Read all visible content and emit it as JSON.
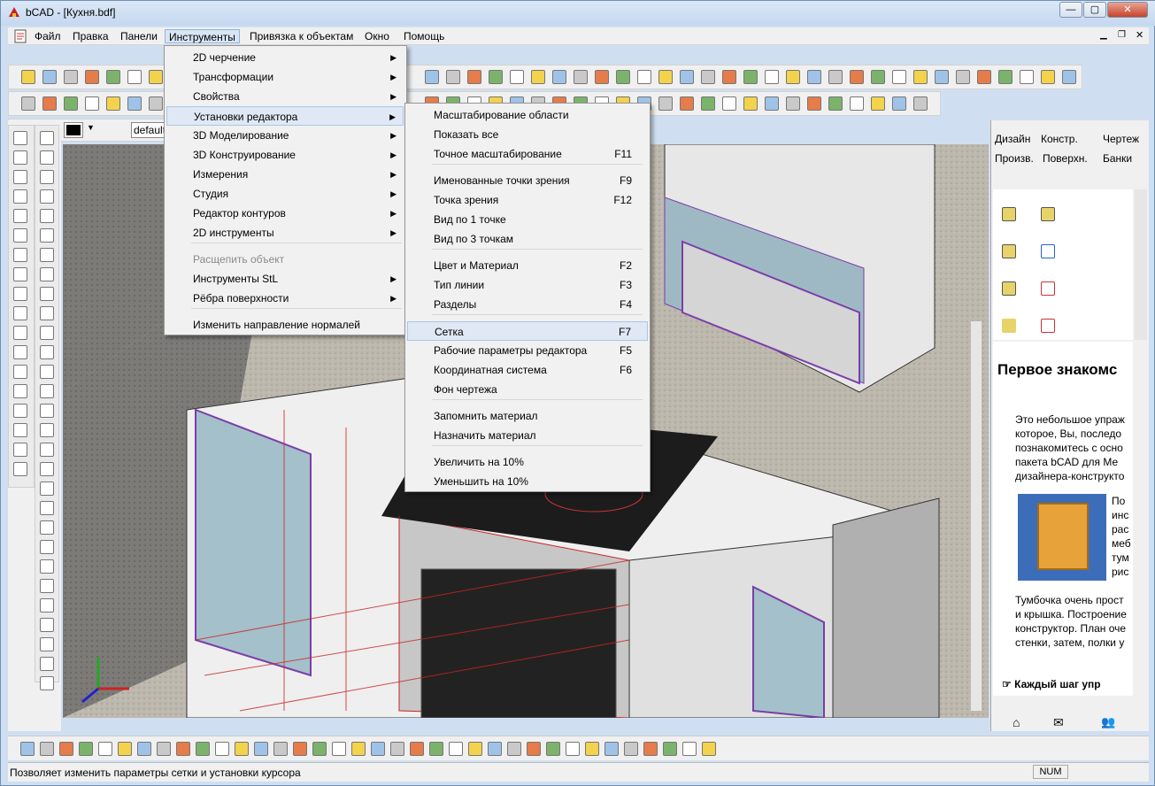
{
  "window": {
    "title": "bCAD - [Кухня.bdf]",
    "min": "—",
    "max": "▢",
    "close": "✕"
  },
  "menubar": [
    "Файл",
    "Правка",
    "Панели",
    "Инструменты",
    "Привязка к объектам",
    "Окно",
    "Помощь"
  ],
  "toolbar": {
    "layer_value": "default"
  },
  "tools_menu": {
    "items": [
      {
        "label": "2D черчение",
        "sub": true
      },
      {
        "label": "Трансформации",
        "sub": true
      },
      {
        "label": "Свойства",
        "sub": true
      },
      {
        "label": "Установки редактора",
        "sub": true,
        "active": true
      },
      {
        "label": "3D Моделирование",
        "sub": true
      },
      {
        "label": "3D Конструирование",
        "sub": true
      },
      {
        "label": "Измерения",
        "sub": true
      },
      {
        "label": "Студия",
        "sub": true
      },
      {
        "label": "Редактор контуров",
        "sub": true
      },
      {
        "label": "2D инструменты",
        "sub": true
      },
      {
        "label": "Расщепить объект",
        "disabled": true
      },
      {
        "label": "Инструменты StL",
        "sub": true
      },
      {
        "label": "Рёбра поверхности",
        "sub": true
      },
      {
        "label": "Изменить направление нормалей"
      }
    ]
  },
  "editor_menu": {
    "items": [
      {
        "label": "Масштабирование области",
        "shortcut": ""
      },
      {
        "label": "Показать все",
        "shortcut": ""
      },
      {
        "label": "Точное масштабирование",
        "shortcut": "F11"
      },
      {
        "label": "Именованные точки зрения",
        "shortcut": "F9"
      },
      {
        "label": "Точка зрения",
        "shortcut": "F12"
      },
      {
        "label": "Вид по 1 точке",
        "shortcut": ""
      },
      {
        "label": "Вид по 3 точкам",
        "shortcut": ""
      },
      {
        "label": "Цвет и Материал",
        "shortcut": "F2"
      },
      {
        "label": "Тип линии",
        "shortcut": "F3"
      },
      {
        "label": "Разделы",
        "shortcut": "F4"
      },
      {
        "label": "Сетка",
        "shortcut": "F7",
        "highlighted": true
      },
      {
        "label": "Рабочие параметры редактора",
        "shortcut": "F5"
      },
      {
        "label": "Координатная система",
        "shortcut": "F6"
      },
      {
        "label": "Фон чертежа",
        "shortcut": ""
      },
      {
        "label": "Запомнить материал",
        "shortcut": ""
      },
      {
        "label": "Назначить материал",
        "shortcut": ""
      },
      {
        "label": "Увеличить на 10%",
        "shortcut": ""
      },
      {
        "label": "Уменьшить на 10%",
        "shortcut": ""
      }
    ]
  },
  "right_panel": {
    "tabs_row1": [
      "Дизайн",
      "Констр.",
      "Чертеж"
    ],
    "tabs_row2": [
      "Произв.",
      "Поверхн.",
      "Банки"
    ],
    "help_title": "Первое знакомс",
    "help_para1": [
      "Это небольшое упраж",
      "которое, Вы, последо",
      "познакомитесь с осно",
      "пакета bCAD для Ме",
      "дизайнера-конструкто"
    ],
    "help_side": [
      "По",
      "инс",
      "рас",
      "меб",
      "тум",
      "рис"
    ],
    "help_para2": [
      "Тумбочка очень прост",
      "и крышка. Построение",
      "конструктор. План оче",
      "стенки, затем, полки у"
    ],
    "help_link": "Каждый шаг упр"
  },
  "status": {
    "text": "Позволяет изменить параметры сетки и установки курсора",
    "num": "NUM"
  },
  "colors": {
    "accent": "#8fb2d9",
    "highlight": "#dfe8f4"
  }
}
